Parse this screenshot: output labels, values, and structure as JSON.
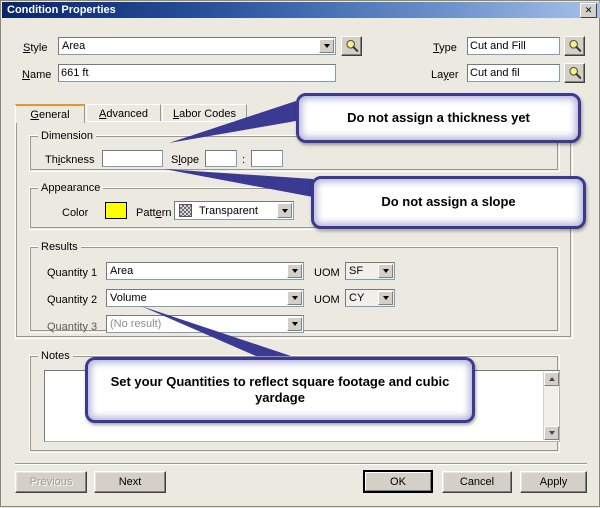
{
  "window": {
    "title": "Condition Properties",
    "close_label": "✕"
  },
  "header_fields": {
    "style": {
      "label": "Style",
      "accel": "S",
      "value": "Area",
      "browse_icon": "magnifier-icon"
    },
    "name": {
      "label": "Name",
      "accel": "N",
      "value": "661 ft"
    },
    "type": {
      "label": "Type",
      "accel": "T",
      "value": "Cut and Fill",
      "browse_icon": "magnifier-icon"
    },
    "layer": {
      "label": "Layer",
      "accel": "y",
      "value": "Cut and fil",
      "browse_icon": "magnifier-icon"
    }
  },
  "tabs": [
    {
      "label": "General",
      "accel": "G",
      "active": true
    },
    {
      "label": "Advanced",
      "accel": "A",
      "active": false
    },
    {
      "label": "Labor Codes",
      "accel": "L",
      "active": false
    }
  ],
  "dimension": {
    "group_label": "Dimension",
    "thickness_label": "Thickness",
    "thickness_accel": "i",
    "thickness_value": "",
    "slope_label": "Slope",
    "slope_accel": "l",
    "slope_value_1": "",
    "slope_separator": ":",
    "slope_value_2": ""
  },
  "appearance": {
    "group_label": "Appearance",
    "color_label": "Color",
    "color_value": "#ffff00",
    "pattern_label": "Pattern",
    "pattern_accel": "e",
    "pattern_value": "Transparent",
    "pattern_icon": "checker-pattern-icon"
  },
  "results": {
    "group_label": "Results",
    "rows": [
      {
        "label": "Quantity 1",
        "value": "Area",
        "uom_label": "UOM",
        "uom_value": "SF",
        "disabled": false
      },
      {
        "label": "Quantity 2",
        "value": "Volume",
        "uom_label": "UOM",
        "uom_value": "CY",
        "disabled": false
      },
      {
        "label": "Quantity 3",
        "value": "(No result)",
        "uom_label": "",
        "uom_value": "",
        "disabled": true
      }
    ]
  },
  "notes": {
    "group_label": "Notes",
    "value": "",
    "scroll_up_icon": "triangle-up-icon",
    "scroll_down_icon": "triangle-down-icon"
  },
  "footer_buttons": {
    "previous": {
      "label": "Previous",
      "disabled": true
    },
    "next": {
      "label": "Next",
      "disabled": false
    },
    "ok": {
      "label": "OK",
      "default": true
    },
    "cancel": {
      "label": "Cancel",
      "default": false
    },
    "apply": {
      "label": "Apply",
      "default": false
    }
  },
  "callouts": [
    {
      "id": "thickness",
      "text": "Do not assign a thickness yet"
    },
    {
      "id": "slope",
      "text": "Do not assign a slope"
    },
    {
      "id": "quantities",
      "text": "Set your Quantities to reflect square footage and cubic yardage"
    }
  ],
  "colors": {
    "title_bar_start": "#0a246a",
    "title_bar_end": "#a8c0e8",
    "dialog_face": "#ece9e0",
    "callout_border": "#3b3a93",
    "active_tab_accent": "#e8923a",
    "swatch_yellow": "#ffff00"
  }
}
